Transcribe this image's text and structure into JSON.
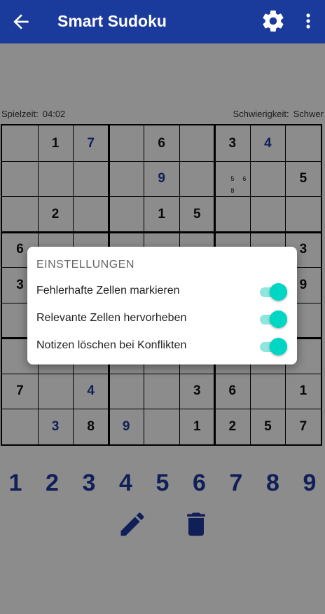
{
  "app": {
    "title": "Smart Sudoku",
    "colors": {
      "appbar": "#1a3a9c",
      "accent": "#00d6c4",
      "user_digit": "#1f3aa0"
    }
  },
  "status": {
    "time_label": "Spielzeit:",
    "time_value": "04:02",
    "difficulty_label": "Schwierigkeit:",
    "difficulty_value": "Schwer"
  },
  "board": {
    "cells": [
      [
        "",
        "1",
        "7u",
        "",
        "6",
        "",
        "3",
        "4u",
        ""
      ],
      [
        "",
        "",
        "",
        "",
        "9u",
        "",
        "n:5,6,8",
        "",
        "5"
      ],
      [
        "",
        "2",
        "",
        "",
        "1",
        "5",
        "",
        "",
        ""
      ],
      [
        "6",
        "",
        "",
        "",
        "",
        "",
        "",
        "",
        "3"
      ],
      [
        "3",
        "",
        "",
        "",
        "",
        "",
        "",
        "",
        "9"
      ],
      [
        "",
        "",
        "",
        "",
        "",
        "",
        "",
        "",
        ""
      ],
      [
        "",
        "",
        "",
        "",
        "",
        "",
        "",
        "",
        ""
      ],
      [
        "7",
        "",
        "4u",
        "",
        "",
        "3",
        "6",
        "",
        "1"
      ],
      [
        "",
        "3u",
        "8",
        "9u",
        "",
        "1",
        "2",
        "5",
        "7"
      ]
    ]
  },
  "numpad": {
    "digits": [
      "1",
      "2",
      "3",
      "4",
      "5",
      "6",
      "7",
      "8",
      "9"
    ]
  },
  "tools": {
    "edit_icon": "pencil-icon",
    "delete_icon": "trash-icon"
  },
  "dialog": {
    "title": "EINSTELLUNGEN",
    "options": [
      {
        "label": "Fehlerhafte Zellen markieren",
        "enabled": true
      },
      {
        "label": "Relevante Zellen hervorheben",
        "enabled": true
      },
      {
        "label": "Notizen löschen bei Konflikten",
        "enabled": true
      }
    ]
  }
}
